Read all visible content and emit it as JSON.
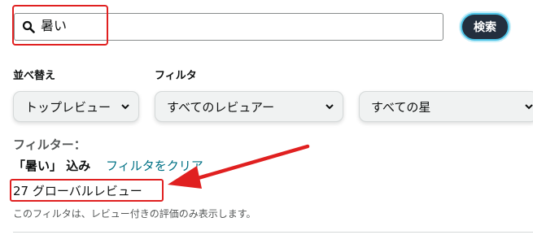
{
  "search": {
    "value": "暑い",
    "button_label": "検索"
  },
  "sort": {
    "label": "並べ替え",
    "selected": "トップレビュー"
  },
  "filter": {
    "label": "フィルタ",
    "reviewer_selected": "すべてのレビュアー",
    "star_selected": "すべての星"
  },
  "active_filters": {
    "heading": "フィルター：",
    "term": "「暑い」 込み",
    "clear_link": "フィルタをクリア"
  },
  "results": {
    "count_text": "27 グローバルレビュー",
    "note": "このフィルタは、レビュー付きの評価のみ表示します。"
  },
  "colors": {
    "annotation": "#e02020",
    "link": "#007185",
    "button_bg": "#232f3e",
    "button_ring": "#4cc3e6"
  }
}
